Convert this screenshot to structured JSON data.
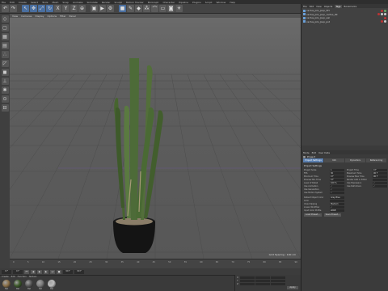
{
  "menubar": {
    "items": [
      "File",
      "Edit",
      "Create",
      "Select",
      "Tools",
      "Mesh",
      "Snap",
      "Animate",
      "Simulate",
      "Render",
      "Sculpt",
      "Motion Tracker",
      "MoGraph",
      "Character",
      "Pipeline",
      "Plugins",
      "Script",
      "Window",
      "Help"
    ]
  },
  "viewport": {
    "menu": [
      "View",
      "Cameras",
      "Display",
      "Options",
      "Filter",
      "Panel"
    ],
    "status": "Grid Spacing : 100 cm"
  },
  "timeline": {
    "ticks": [
      "0",
      "5",
      "10",
      "15",
      "20",
      "25",
      "30",
      "35",
      "40",
      "45",
      "50",
      "55",
      "60",
      "65",
      "70",
      "75",
      "80",
      "85",
      "90"
    ],
    "start_frame": "0 F",
    "current_frame": "0 F",
    "end_frame": "90 F",
    "max_frame": "90 F"
  },
  "materials": {
    "menu": [
      "Create",
      "Edit",
      "Function",
      "Texture"
    ],
    "items": [
      {
        "label": "Mat",
        "color": "#8a7048"
      },
      {
        "label": "Mat",
        "color": "#3d5a2a"
      },
      {
        "label": "Mat",
        "color": "#575757"
      },
      {
        "label": "Mat",
        "color": "#7b7b7b"
      },
      {
        "label": "Mat",
        "color": "#bdbdbd"
      }
    ]
  },
  "coords": {
    "rows": [
      "X",
      "Y",
      "Z"
    ],
    "apply": "Apply"
  },
  "object_manager": {
    "menu": [
      "File",
      "Edit",
      "View",
      "Objects",
      "Tags",
      "Bookmarks"
    ],
    "objects": [
      {
        "name": "cactus_pilo_Joop_HH",
        "tags": [
          "r",
          "g"
        ]
      },
      {
        "name": "cactus_pilo_Joop_cactus_00",
        "tags": [
          "r",
          "w",
          "w"
        ]
      },
      {
        "name": "cactus_pilo_Joop_soil",
        "tags": [
          "r"
        ]
      },
      {
        "name": "cactus_pilo_Joop_pot",
        "tags": [
          "r",
          "w"
        ]
      }
    ]
  },
  "attributes": {
    "menu": [
      "Mode",
      "Edit",
      "User Data"
    ],
    "header": "Project",
    "tabs": [
      "Project Settings",
      "Info",
      "Dynamics",
      "Referencing"
    ],
    "section_title": "Project Settings",
    "fields_left": [
      {
        "label": "Project Scale",
        "value": "1"
      },
      {
        "label": "FPS",
        "value": "30"
      },
      {
        "label": "Minimum Time",
        "value": "0 F"
      },
      {
        "label": "Preview Min Time",
        "value": "0 F"
      },
      {
        "label": "Level of Detail",
        "value": "100 %"
      },
      {
        "label": "Use Animation",
        "value": "✓"
      },
      {
        "label": "Use Generators",
        "value": "✓"
      },
      {
        "label": "Use Motion System",
        "value": "✓"
      }
    ],
    "fields_right": [
      {
        "label": "Project Time",
        "value": "0 F"
      },
      {
        "label": "Maximum Time",
        "value": "90 F"
      },
      {
        "label": "Preview Max Time",
        "value": "90 F"
      },
      {
        "label": "Render LOD in Editor",
        "value": ""
      },
      {
        "label": "Use Expression",
        "value": "✓"
      },
      {
        "label": "Use Deformers",
        "value": "✓"
      }
    ],
    "extra_fields": [
      {
        "label": "Default Object Color",
        "value": "Gray Blue"
      },
      {
        "label": "Color",
        "value": ""
      },
      {
        "label": "View Clipping",
        "value": "Medium"
      },
      {
        "label": "Linear Workflow",
        "value": "✓"
      },
      {
        "label": "Input Color Profile",
        "value": "sRGB"
      }
    ],
    "buttons": [
      "Load Preset...",
      "Save Preset..."
    ]
  }
}
